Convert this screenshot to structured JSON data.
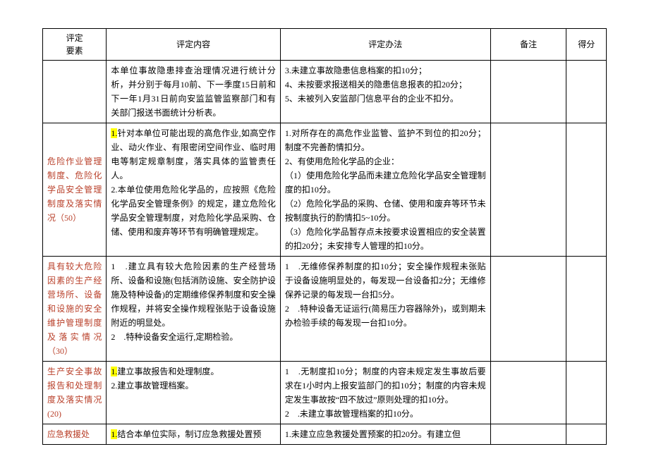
{
  "header": {
    "col1_line1": "评定",
    "col1_line2": "要素",
    "col2": "评定内容",
    "col3": "评定办法",
    "col4": "备注",
    "col5": "得分"
  },
  "rows": [
    {
      "elem": "",
      "elem_class": "elem-id",
      "content_prefix": "",
      "content": "本单位事故隐患排查治理情况进行统计分析，并分别于每月10前、下一季度15日前和下一年1月31日前向安监监管监察部门和有关部门报送书面统计分析表。",
      "method": "3.未建立事故隐患信息档案的扣10分；\n4、未按要求报送相关的隐患信息报表的扣20分；\n5、未被列入安监部门信息平台的企业不扣分。",
      "remark": "",
      "score": ""
    },
    {
      "elem": "危险作业管理制度、危险化学品安全管理制度及落实情况（50）",
      "elem_class": "elem",
      "content_prefix": "1.",
      "content": "针对本单位可能出现的高危作业,如高空作业、动火作业、有限密闭空间作业、临时用电等制定规章制度，落实具体的监管责任人。\n2.本单位使用危险化学品的，应按照《危险化学品安全管理条例》的规定，建立危险化学品安全管理制度，对危险化学品采购、仓储、使用和废弃等环节有明确管理规定。",
      "method": "1.对所存在的高危作业监管、监护不到位的扣20分；制度不完善酌情扣分。\n2、有使用危险化学品的企业：\n（1）使用危险化学品而未建立危险化学品安全管理制度的扣10分。\n（2）危险化学品的采购、仓储、使用和废弃等环节未按制度执行的酌情扣5~10分。\n（3）危险化学品暂存点未按要求设置相应的安全装置的扣20分；未安排专人管理的扣10分。",
      "remark": "",
      "score": ""
    },
    {
      "elem": "具有较大危险因素的生产经营场所、设备和设施的安全维护管理制度及落实情况（30）",
      "elem_class": "elem",
      "content_prefix": "",
      "content": "1　.建立具有较大危险因素的生产经营场所、设备和设施(包括消防设施、安全防护设施及特种设备)的定期维修保养制度和安全操作规程，并将安全操作规程张贴于设备设施附近的明显处。\n2　.特种设备安全运行,定期检验。",
      "method": "1　.无维修保养制度的扣10分；安全操作规程未张贴于设备设施明显处的，每发现一台设备扣2分；无维修保养记录的每发现一台扣5分。\n2　.特种设备无证运行(简易压力容器除外)，或到期未办检验手续的每发现一台扣10分。",
      "remark": "",
      "score": ""
    },
    {
      "elem": "生产安全事故报告和处理制度及落实情况(20)",
      "elem_class": "elem-accident",
      "content_prefix": "1.",
      "content": "建立事故报告和处理制度。\n2.建立事故管理档案。",
      "method": "1　.无制度扣10分；制度的内容未规定发生事故后要求在1小时内上报安监部门的扣10分；制度的内容未规定发生事故按“四不放过”原则处理的扣10分。\n2　.未建立事故管理档案的扣10分。",
      "remark": "",
      "score": ""
    },
    {
      "elem": "应急救援处",
      "elem_class": "elem",
      "content_prefix": "1.",
      "content": "结合本单位实际，制订应急救援处置预",
      "method": "1.未建立应急救援处置预案的扣20分。有建立但",
      "remark": "",
      "score": ""
    }
  ]
}
